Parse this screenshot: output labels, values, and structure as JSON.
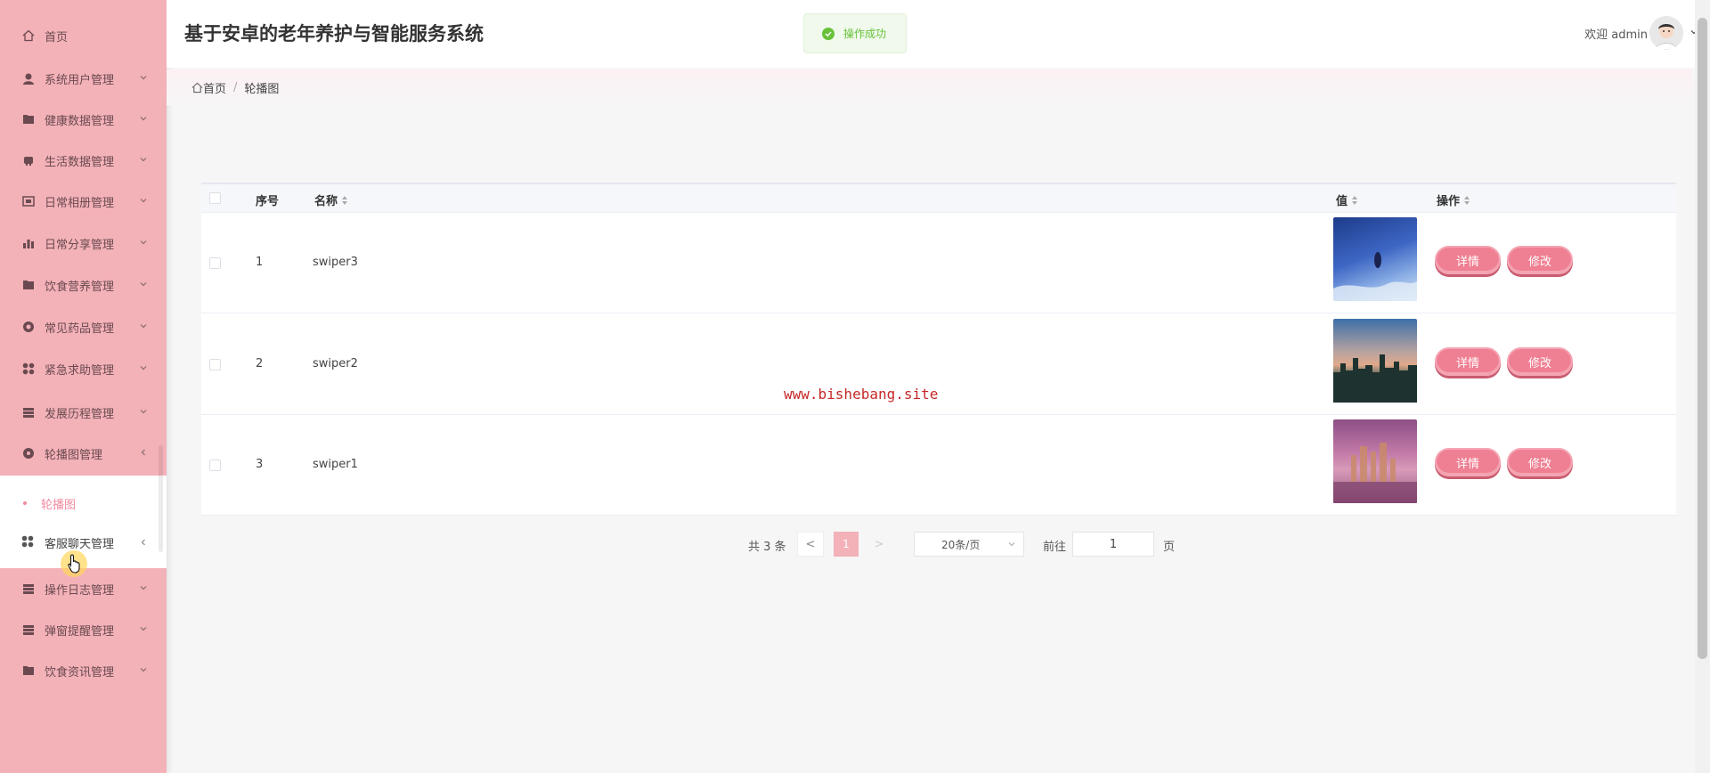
{
  "app": {
    "title": "基于安卓的老年养护与智能服务系统",
    "welcome": "欢迎 admin",
    "toast": "操作成功"
  },
  "sidebar": {
    "items": [
      {
        "label": "首页",
        "icon": "home-icon"
      },
      {
        "label": "系统用户管理",
        "icon": "user-icon"
      },
      {
        "label": "健康数据管理",
        "icon": "folder-icon"
      },
      {
        "label": "生活数据管理",
        "icon": "robot-icon"
      },
      {
        "label": "日常相册管理",
        "icon": "album-icon"
      },
      {
        "label": "日常分享管理",
        "icon": "chart-icon"
      },
      {
        "label": "饮食营养管理",
        "icon": "folder-icon"
      },
      {
        "label": "常见药品管理",
        "icon": "pill-icon"
      },
      {
        "label": "紧急求助管理",
        "icon": "grid-icon"
      },
      {
        "label": "发展历程管理",
        "icon": "list-icon"
      },
      {
        "label": "轮播图管理",
        "icon": "image-icon"
      }
    ],
    "submenu_active": "轮播图",
    "chat_item": "客服聊天管理",
    "after_items": [
      {
        "label": "操作日志管理",
        "icon": "list-icon"
      },
      {
        "label": "弹窗提醒管理",
        "icon": "list-icon"
      },
      {
        "label": "饮食资讯管理",
        "icon": "folder-icon"
      }
    ]
  },
  "breadcrumb": {
    "home": "首页",
    "separator": "/",
    "current": "轮播图"
  },
  "table": {
    "headers": {
      "index": "序号",
      "name": "名称",
      "value": "值",
      "actions": "操作"
    },
    "rows": [
      {
        "index": "1",
        "name": "swiper3",
        "image": "sky-blue"
      },
      {
        "index": "2",
        "name": "swiper2",
        "image": "city-dusk"
      },
      {
        "index": "3",
        "name": "swiper1",
        "image": "city-pink"
      }
    ],
    "detail_label": "详情",
    "edit_label": "修改"
  },
  "watermark": "www.bishebang.site",
  "pagination": {
    "total": "共 3 条",
    "prev": "<",
    "current": "1",
    "next": ">",
    "page_size": "20条/页",
    "goto": "前往",
    "goto_value": "1",
    "page_suffix": "页"
  },
  "colors": {
    "sidebar": "#f3b1b8",
    "accent": "#ef7f92",
    "success": "#67c23a"
  }
}
